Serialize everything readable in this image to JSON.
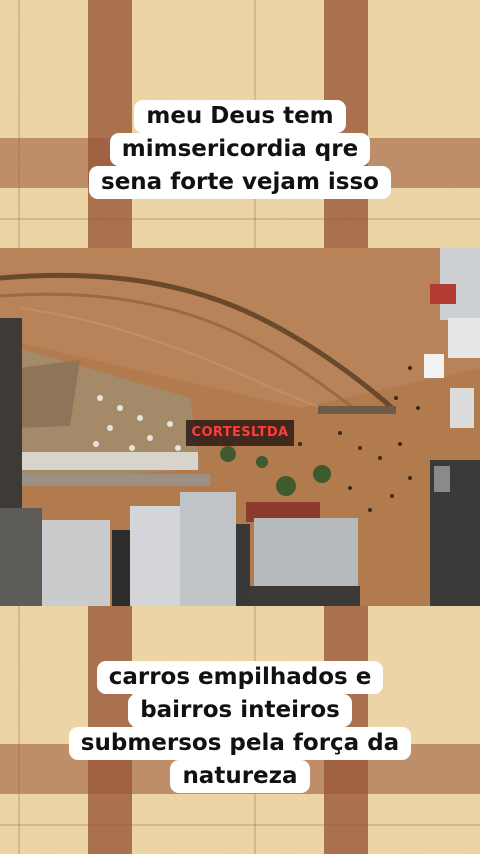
{
  "captions": {
    "top": [
      "meu Deus tem",
      "mimsericordia qre",
      "sena forte vejam isso"
    ],
    "bottom": [
      "carros empilhados e",
      "bairros inteiros",
      "submersos pela força da",
      "natureza"
    ]
  },
  "watermark": "CORTESLTDA",
  "colors": {
    "mud": "#b07a4d",
    "plaid_base": "#ebd3a3",
    "plaid_stripe": "#985537",
    "watermark_text": "#ff3d3d"
  }
}
